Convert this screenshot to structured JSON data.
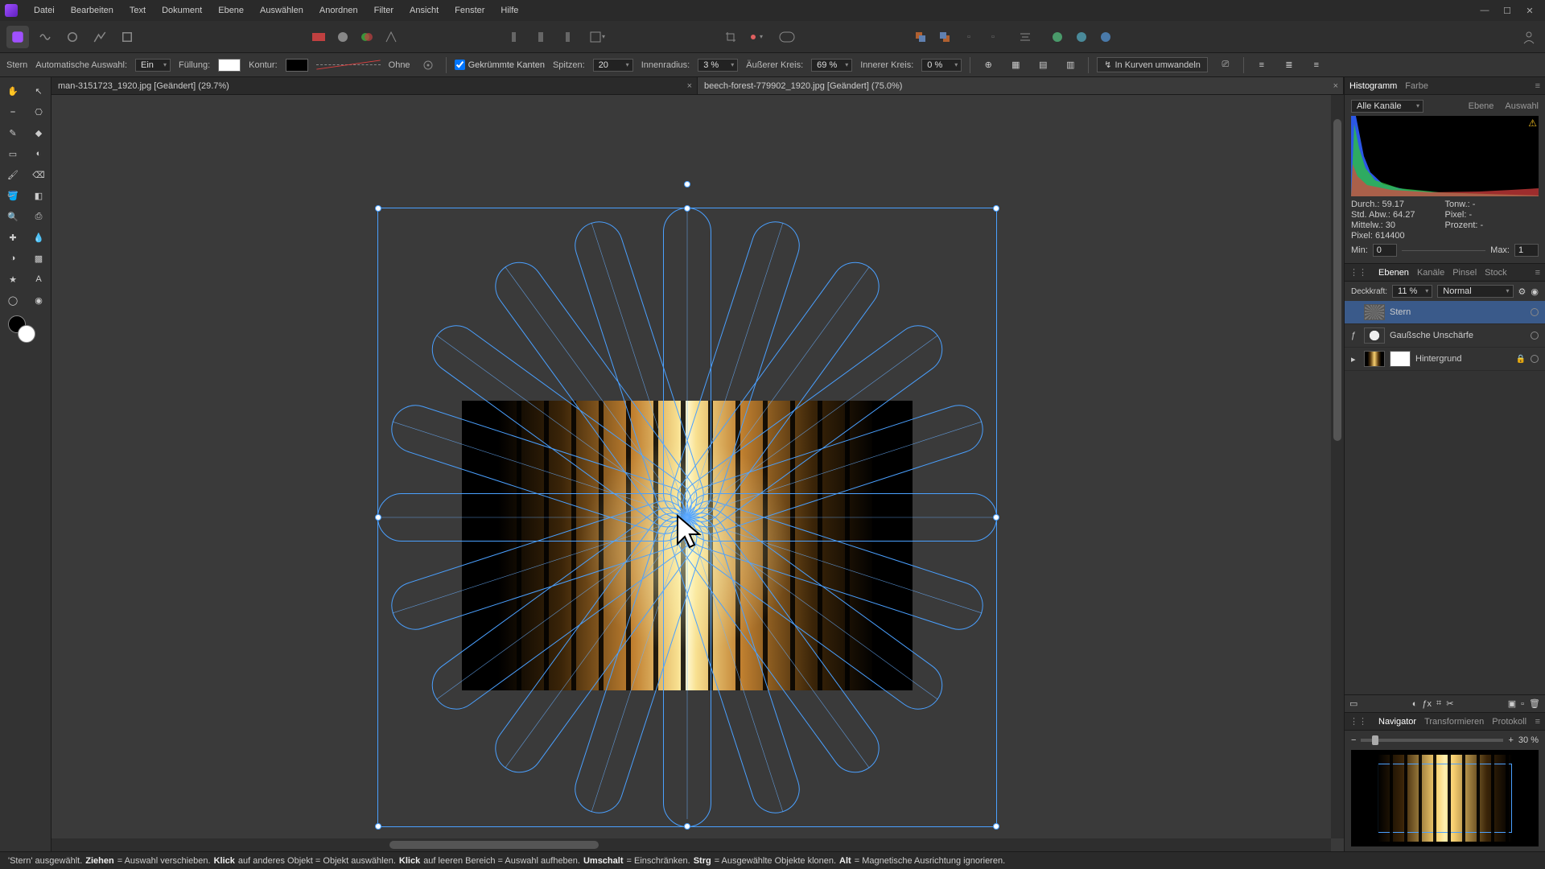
{
  "menu": [
    "Datei",
    "Bearbeiten",
    "Text",
    "Dokument",
    "Ebene",
    "Auswählen",
    "Anordnen",
    "Filter",
    "Ansicht",
    "Fenster",
    "Hilfe"
  ],
  "context": {
    "tool": "Stern",
    "auto_sel_label": "Automatische Auswahl:",
    "auto_sel_value": "Ein",
    "fill_label": "Füllung:",
    "stroke_label": "Kontur:",
    "stroke_style": "Ohne",
    "smooth_label": "Gekrümmte Kanten",
    "points_label": "Spitzen:",
    "points_value": "20",
    "inner_radius_label": "Innenradius:",
    "inner_radius_value": "3 %",
    "outer_circle_label": "Äußerer Kreis:",
    "outer_circle_value": "69 %",
    "inner_circle_label": "Innerer Kreis:",
    "inner_circle_value": "0 %",
    "convert_label": "In Kurven umwandeln"
  },
  "tabs": [
    {
      "title": "man-3151723_1920.jpg [Geändert] (29.7%)",
      "active": false
    },
    {
      "title": "beech-forest-779902_1920.jpg [Geändert] (75.0%)",
      "active": true
    }
  ],
  "histogram": {
    "tabs": [
      "Histogramm",
      "Farbe"
    ],
    "channel_value": "Alle Kanäle",
    "mode_tabs": [
      "Ebene",
      "Auswahl"
    ],
    "stats": {
      "durch": "Durch.: 59.17",
      "std": "Std. Abw.: 64.27",
      "mittel": "Mittelw.: 30",
      "pixel": "Pixel: 614400",
      "tonw": "Tonw.: -",
      "pixel2": "Pixel: -",
      "proz": "Prozent: -"
    },
    "min_label": "Min:",
    "min_value": "0",
    "max_label": "Max:",
    "max_value": "1"
  },
  "layers": {
    "tabs": [
      "Ebenen",
      "Kanäle",
      "Pinsel",
      "Stock"
    ],
    "opacity_label": "Deckkraft:",
    "opacity_value": "11 %",
    "blend_value": "Normal",
    "items": [
      {
        "name": "Stern",
        "selected": true,
        "thumb": "stern"
      },
      {
        "name": "Gaußsche Unschärfe",
        "fx": true,
        "thumb": "circle"
      },
      {
        "name": "Hintergrund",
        "locked": true,
        "thumb": "forest",
        "mask": true
      }
    ]
  },
  "nav": {
    "tabs": [
      "Navigator",
      "Transformieren",
      "Protokoll"
    ],
    "zoom_value": "30 %"
  },
  "status": {
    "parts": [
      "'Stern' ausgewählt. ",
      "Ziehen",
      " = Auswahl verschieben. ",
      "Klick",
      " auf anderes Objekt = Objekt auswählen. ",
      "Klick",
      " auf leeren Bereich = Auswahl aufheben. ",
      "Umschalt",
      " = Einschränken. ",
      "Strg",
      " = Ausgewählte Objekte klonen. ",
      "Alt",
      " = Magnetische Ausrichtung ignorieren."
    ]
  },
  "colors": {
    "accent": "#4aa0ff"
  }
}
